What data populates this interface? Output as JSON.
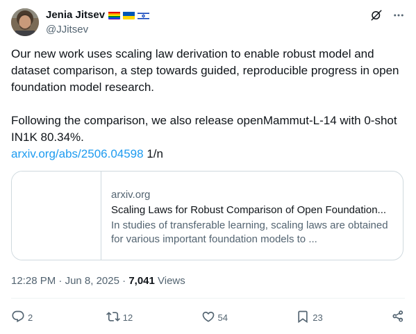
{
  "author": {
    "display_name": "Jenia Jitsev",
    "handle": "@JJitsev",
    "flags": [
      "rainbow-flag",
      "ukraine-flag",
      "israel-flag"
    ]
  },
  "header_icons": [
    "grok-icon",
    "more-icon"
  ],
  "tweet": {
    "paragraph_1": "Our new work uses scaling law derivation to enable robust model and dataset comparison, a step towards guided, reproducible progress in open foundation model research.",
    "paragraph_2": "Following the comparison, we also release openMammut-L-14 with 0-shot IN1K 80.34%.",
    "link_text": "arxiv.org/abs/2506.04598",
    "link_suffix": " 1/n"
  },
  "card": {
    "domain": "arxiv.org",
    "title": "Scaling Laws for Robust Comparison of Open Foundation...",
    "description": "In studies of transferable learning, scaling laws are obtained for various important foundation models to ..."
  },
  "meta": {
    "time": "12:28 PM",
    "separator": " · ",
    "date": "Jun 8, 2025",
    "views_count": "7,041",
    "views_label": " Views"
  },
  "actions": {
    "replies": "2",
    "reposts": "12",
    "likes": "54",
    "bookmarks": "23"
  },
  "colors": {
    "text": "#0f1419",
    "secondary": "#536471",
    "link": "#1d9bf0",
    "border": "#cfd9de"
  }
}
